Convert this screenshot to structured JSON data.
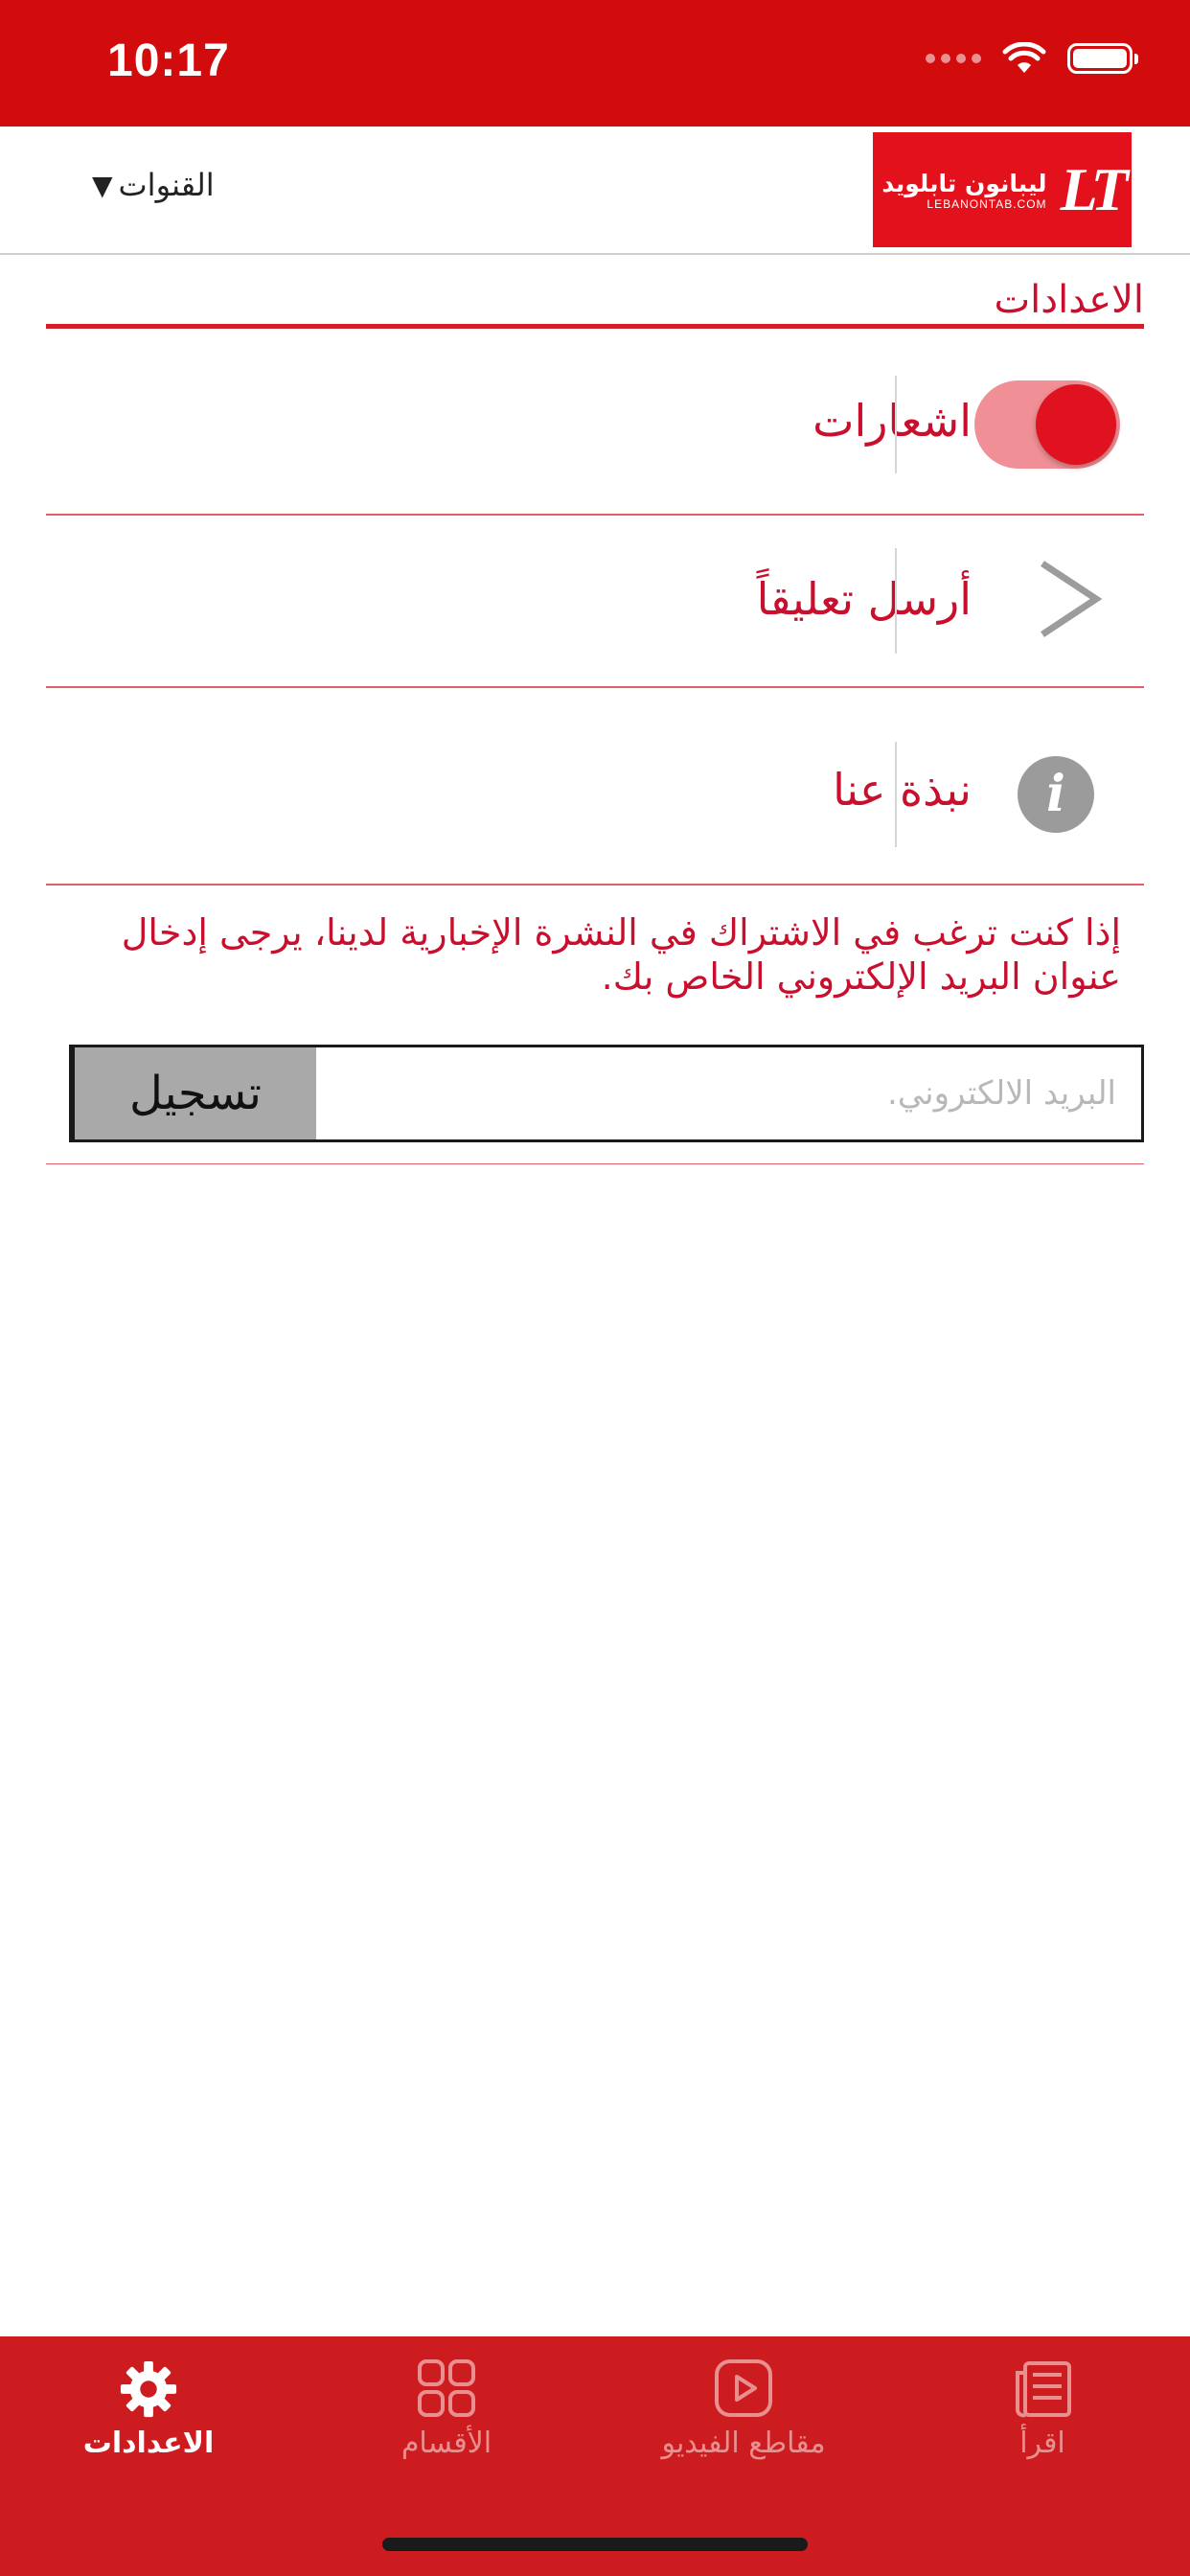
{
  "status": {
    "time": "10:17"
  },
  "header": {
    "channels_label": "القنوات",
    "dropdown_glyph": "▼",
    "logo": {
      "monogram": "LT",
      "arabic": "ليبانون تابلويد",
      "site": "LEBANONTAB.COM"
    }
  },
  "settings": {
    "title": "الاعدادات",
    "rows": [
      {
        "label": "اشعارات",
        "control": "toggle",
        "checked": true
      },
      {
        "label": "أرسل تعليقاً",
        "control": "chevron-right-icon"
      },
      {
        "label": "نبذة عنا",
        "control": "info-icon",
        "glyph": "i"
      }
    ],
    "newsletter_text": "إذا كنت ترغب في الاشتراك في النشرة الإخبارية لدينا، يرجى إدخال عنوان البريد الإلكتروني الخاص بك.",
    "email_placeholder": "البريد الالكتروني.",
    "register_label": "تسجيل"
  },
  "tabbar": {
    "tabs": [
      {
        "label": "اقرأ",
        "icon": "newspaper-icon",
        "active": false
      },
      {
        "label": "مقاطع الفيديو",
        "icon": "play-icon",
        "active": false
      },
      {
        "label": "الأقسام",
        "icon": "grid-icon",
        "active": false
      },
      {
        "label": "الاعدادات",
        "icon": "gear-icon",
        "active": true
      }
    ]
  },
  "colors": {
    "brand_red": "#d20c0c",
    "text_red": "#c8102e",
    "tabbar_red": "#cd1c1f",
    "toggle_on_track": "#f08f95"
  }
}
